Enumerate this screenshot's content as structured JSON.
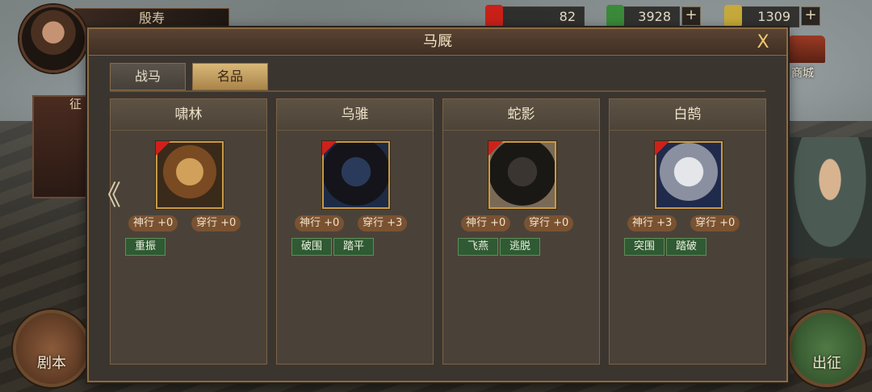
{
  "player": {
    "name": "殷寿"
  },
  "resources": [
    {
      "value": "82",
      "icon": "red-token-icon",
      "color": "#c9201a"
    },
    {
      "value": "3928",
      "icon": "jade-coin-icon",
      "color": "#3b8a3a"
    },
    {
      "value": "1309",
      "icon": "gold-ingot-icon",
      "color": "#c6a93a"
    }
  ],
  "plus_symbol": "+",
  "side_left": {
    "label": "征"
  },
  "shop": {
    "label": "商城"
  },
  "buttons": {
    "script": "剧本",
    "march": "出征"
  },
  "dialog": {
    "title": "马厩",
    "close": "X",
    "tabs": [
      {
        "label": "战马",
        "active": false
      },
      {
        "label": "名品",
        "active": true
      }
    ],
    "cards": [
      {
        "name": "啸林",
        "portrait_icon": "tiger-icon",
        "stats": [
          "神行 +0",
          "穿行 +0"
        ],
        "skills": [
          "重振"
        ]
      },
      {
        "name": "乌骓",
        "portrait_icon": "black-horse-icon",
        "stats": [
          "神行 +0",
          "穿行 +3"
        ],
        "skills": [
          "破围",
          "踏平"
        ]
      },
      {
        "name": "蛇影",
        "portrait_icon": "dark-horse-icon",
        "stats": [
          "神行 +0",
          "穿行 +0"
        ],
        "skills": [
          "飞燕",
          "逃脱"
        ]
      },
      {
        "name": "白鹄",
        "portrait_icon": "white-horse-icon",
        "stats": [
          "神行 +3",
          "穿行 +0"
        ],
        "skills": [
          "突围",
          "踏破"
        ]
      }
    ]
  },
  "nav": {
    "left_arrow": "《"
  }
}
